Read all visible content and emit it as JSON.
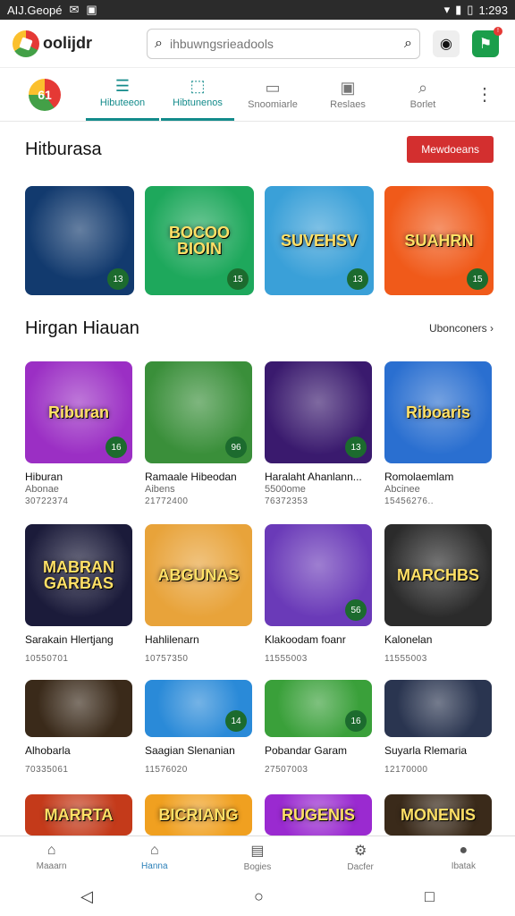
{
  "status_bar": {
    "carrier": "AIJ.Geopé",
    "time": "1:293"
  },
  "header": {
    "logo_text": "oolijdr",
    "search_placeholder": "ihbuwngsrieadools"
  },
  "category_tabs": [
    {
      "label": "Hibuteeon",
      "icon": "list-icon",
      "active": true
    },
    {
      "label": "Hibtunenos",
      "icon": "tag-icon",
      "active": true
    },
    {
      "label": "Snoomiarle",
      "icon": "tv-icon",
      "active": false
    },
    {
      "label": "Reslaes",
      "icon": "robot-icon",
      "active": false
    },
    {
      "label": "Borlet",
      "icon": "search-icon",
      "active": false
    }
  ],
  "category_logo_text": "61",
  "section1": {
    "title": "Hitburasa",
    "button": "Mewdoeans"
  },
  "featured": [
    {
      "art": "",
      "badge": "13",
      "bg": "#123a6e"
    },
    {
      "art": "BOCOO BIOIN",
      "badge": "15",
      "bg": "#1ea85c"
    },
    {
      "art": "SUVEHSV",
      "badge": "13",
      "bg": "#3aa0d8"
    },
    {
      "art": "SUAHRN",
      "badge": "15",
      "bg": "#f05a1a"
    }
  ],
  "section2": {
    "title": "Hirgan Hiauan",
    "see_all": "Ubonconers"
  },
  "games": [
    {
      "name": "Hiburan",
      "sub": "Abonae",
      "num": "30722374",
      "badge": "16",
      "art": "Riburan",
      "bg": "#9b2fc4"
    },
    {
      "name": "Ramaale Hibeodan",
      "sub": "Aibens",
      "num": "21772400",
      "badge": "96",
      "art": "",
      "bg": "#3a8f3a"
    },
    {
      "name": "Haralaht Ahanlann...",
      "sub": "5500ome",
      "num": "76372353",
      "badge": "13",
      "art": "",
      "bg": "#3a1a6e"
    },
    {
      "name": "Romolaemlam",
      "sub": "Abcinee",
      "num": "15456276..",
      "badge": "",
      "art": "Riboaris",
      "bg": "#2a6fd0"
    },
    {
      "name": "Sarakain Hlertjang",
      "sub": "",
      "num": "10550701",
      "badge": "",
      "art": "MABRAN GARBAS",
      "bg": "#1b1b3a"
    },
    {
      "name": "Hahlilenarn",
      "sub": "",
      "num": "10757350",
      "badge": "",
      "art": "ABGUNAS",
      "bg": "#e8a33a"
    },
    {
      "name": "Klakoodam foanr",
      "sub": "",
      "num": "11555003",
      "badge": "56",
      "art": "",
      "bg": "#6a3ab8"
    },
    {
      "name": "Kalonelan",
      "sub": "",
      "num": "11555003",
      "badge": "",
      "art": "MARCHBS",
      "bg": "#2b2b2b"
    },
    {
      "name": "Alhobarla",
      "sub": "",
      "num": "70335061",
      "badge": "",
      "art": "",
      "bg": "#3a2a1a"
    },
    {
      "name": "Saagian Slenanian",
      "sub": "",
      "num": "11576020",
      "badge": "14",
      "art": "",
      "bg": "#2a8ad8"
    },
    {
      "name": "Pobandar Garam",
      "sub": "",
      "num": "27507003",
      "badge": "16",
      "art": "",
      "bg": "#3aa03a"
    },
    {
      "name": "Suyarla Rlemaria",
      "sub": "",
      "num": "12170000",
      "badge": "",
      "art": "",
      "bg": "#2a3550"
    },
    {
      "name": "",
      "sub": "",
      "num": "",
      "badge": "",
      "art": "MARRTA",
      "bg": "#c43a1a"
    },
    {
      "name": "",
      "sub": "",
      "num": "",
      "badge": "",
      "art": "BICRIANG",
      "bg": "#f0a020"
    },
    {
      "name": "",
      "sub": "",
      "num": "",
      "badge": "",
      "art": "RUGENIS",
      "bg": "#9a2ad0"
    },
    {
      "name": "",
      "sub": "",
      "num": "",
      "badge": "",
      "art": "MONENIS",
      "bg": "#3a2a1a"
    }
  ],
  "bottom_nav": [
    {
      "label": "Maaarn",
      "icon": "home-icon",
      "active": false
    },
    {
      "label": "Hanna",
      "icon": "house-icon",
      "active": true
    },
    {
      "label": "Bogies",
      "icon": "box-icon",
      "active": false
    },
    {
      "label": "Dacfer",
      "icon": "gear-icon",
      "active": false
    },
    {
      "label": "Ibatak",
      "icon": "user-icon",
      "active": false
    }
  ]
}
